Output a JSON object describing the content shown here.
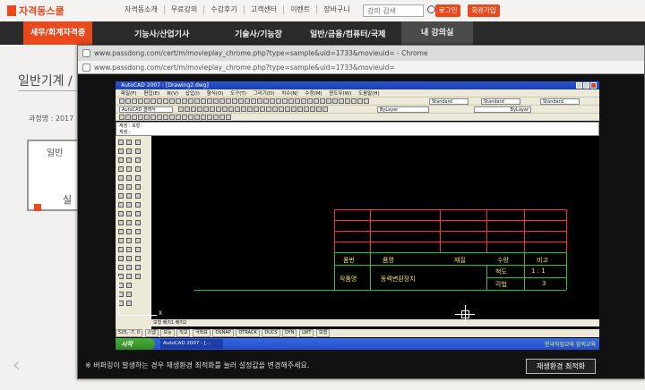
{
  "site": {
    "logo_text": "자격동스쿨",
    "top_links": [
      "자격동소개",
      "무료강의",
      "수강후기",
      "고객센터",
      "이벤트",
      "장바구니"
    ],
    "search_placeholder": "강의 검색",
    "login_label": "로그인",
    "join_label": "회원가입",
    "nav": [
      "세무/회계자격증",
      "기능사/산업기사",
      "기술사/기능장",
      "일반/금융/컴퓨터/국제",
      "내 강의실"
    ],
    "page_title": "일반기계 /",
    "course_label": "과정명 : 2017",
    "card_title": "일반",
    "card_sub": "실"
  },
  "popup": {
    "title": "www.passdong.com/cert/m/movieplay_chrome.php?type=sample&uid=1733&movieuid= - Chrome",
    "address": "www.passdong.com/cert/m/movieplay_chrome.php?type=sample&uid=1733&movieuid=",
    "buffer_note": "※ 버퍼링이 발생하는 경우 재생환경 최적화를 눌러 설정값을 변경해주세요.",
    "optimize_button": "재생환경 최적화"
  },
  "autocad": {
    "title": "AutoCAD 2007 - [Drawing2.dwg]",
    "menu": [
      "파일(F)",
      "편집(E)",
      "뷰(V)",
      "삽입(I)",
      "형식(O)",
      "도구(T)",
      "그리기(D)",
      "치수(N)",
      "수정(M)",
      "윈도우(W)",
      "도움말(H)"
    ],
    "workspace": "AutoCAD 클래식",
    "text_style": "Standard",
    "dim_style": "Standard",
    "layer": "ByLayer",
    "linetype": "ByLayer",
    "command_lines": [
      "재생 : 모형 :",
      "재생 :"
    ],
    "tabs": [
      "모형",
      "배치1",
      "배치2"
    ],
    "status_coords": "525, -7, 0",
    "status_buttons": [
      "스냅",
      "모눈",
      "직교",
      "극좌표",
      "OSNAP",
      "OTRACK",
      "DUCS",
      "DYN",
      "LWT",
      "모형"
    ],
    "start_label": "시작",
    "task_item": "AutoCAD 2007 - [...",
    "tray_text": "한국직업교육 강의교육"
  },
  "title_block": {
    "header": [
      "품번",
      "품명",
      "재질",
      "수량",
      "비고"
    ],
    "row_label": "작품명",
    "row_name": "동력변환장치",
    "scale_label": "척도",
    "scale_value": "1 : 1",
    "angle_label": "각법",
    "angle_value": "3"
  },
  "colors": {
    "accent": "#e8491d",
    "grid_red": "#ff3030",
    "line_green": "#2cc52c",
    "text_yellow": "#f0e070"
  }
}
